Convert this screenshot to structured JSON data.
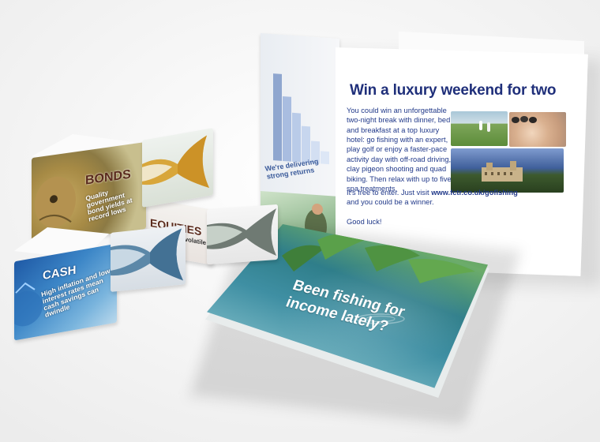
{
  "brochure": {
    "title": "Win a luxury weekend for two",
    "body": "You could win an unforgettable two-night break with dinner, bed and breakfast at a top luxury hotel: go fishing with an expert, play golf or enjoy a faster-pace activity day with off-road driving, clay pigeon shooting and quad biking. Then relax with up to five spa treatments.",
    "enter_prefix": "It's free to enter. Just visit ",
    "enter_url": "www.fctr.co.uk/gofishing",
    "enter_suffix": " and you could be a winner.",
    "sign_off": "Good luck!",
    "left_panel_text": "We're delivering strong returns"
  },
  "cd": {
    "headline_line1": "Been fishing for",
    "headline_line2": "income lately?"
  },
  "cards": {
    "bonds": {
      "label": "BONDS",
      "text": "Quality government bond yields at record lows"
    },
    "equities": {
      "label": "EQUITIES",
      "text": "dividends volatile"
    },
    "cash": {
      "label": "CASH",
      "text": "High inflation and low interest rates mean cash savings can dwindle"
    }
  },
  "colors": {
    "brochure_text": "#223a8a",
    "brochure_title": "#1f2f7a",
    "cd_water": "#3f8fa3",
    "cash_blue": "#1f5aa6",
    "bonds_gold": "#a68a45"
  }
}
